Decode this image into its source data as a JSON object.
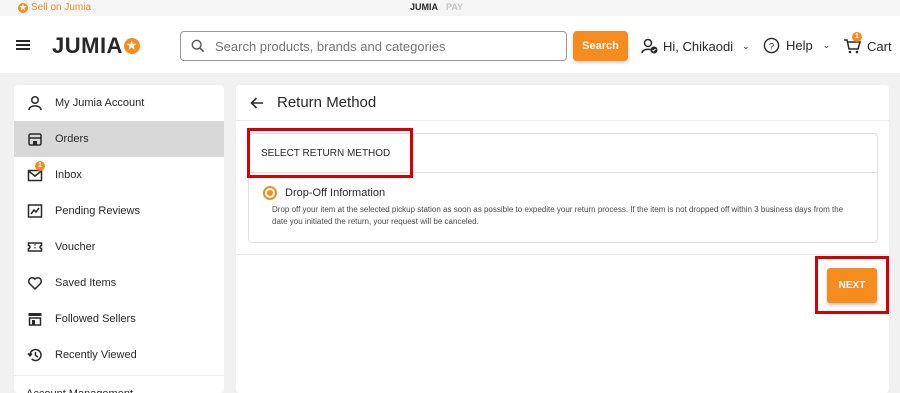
{
  "topstrip": {
    "sell_label": "Sell on Jumia",
    "brand_primary": "JUMIA",
    "brand_secondary": "PAY"
  },
  "header": {
    "logo_text": "JUMIA",
    "search_placeholder": "Search products, brands and categories",
    "search_value": "",
    "search_button": "Search",
    "account_label": "Hi, Chikaodi",
    "help_label": "Help",
    "cart_label": "Cart",
    "cart_count": "1"
  },
  "sidebar": {
    "items": [
      {
        "label": "My Jumia Account",
        "icon": "user-icon"
      },
      {
        "label": "Orders",
        "icon": "orders-icon"
      },
      {
        "label": "Inbox",
        "icon": "mail-icon",
        "badge": "1"
      },
      {
        "label": "Pending Reviews",
        "icon": "reviews-icon"
      },
      {
        "label": "Voucher",
        "icon": "voucher-icon"
      },
      {
        "label": "Saved Items",
        "icon": "heart-icon"
      },
      {
        "label": "Followed Sellers",
        "icon": "store-icon"
      },
      {
        "label": "Recently Viewed",
        "icon": "history-icon"
      }
    ],
    "section_label": "Account Management"
  },
  "main": {
    "title": "Return Method",
    "card_heading": "SELECT RETURN METHOD",
    "option_title": "Drop-Off Information",
    "option_desc": "Drop off your item at the selected pickup station as soon as possible to expedite your return process. If the item is not dropped off within 3 business days from the date you initiated the return, your request will be canceled.",
    "next_button": "NEXT"
  },
  "colors": {
    "accent": "#f68b1e",
    "highlight": "#d50000"
  }
}
